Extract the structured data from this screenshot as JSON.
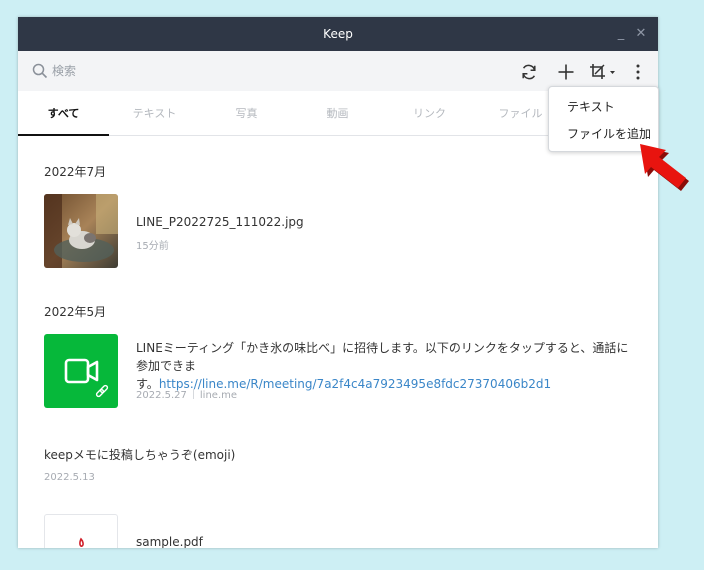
{
  "window": {
    "title": "Keep",
    "minimize_symbol": "_",
    "close_symbol": "✕"
  },
  "toolbar": {
    "search_placeholder": "検索",
    "icons": [
      "search-icon",
      "refresh-icon",
      "plus-icon",
      "crop-icon",
      "more-icon"
    ]
  },
  "tabs": [
    {
      "label": "すべて",
      "active": true
    },
    {
      "label": "テキスト",
      "active": false
    },
    {
      "label": "写真",
      "active": false
    },
    {
      "label": "動画",
      "active": false
    },
    {
      "label": "リンク",
      "active": false
    },
    {
      "label": "ファイル",
      "active": false
    }
  ],
  "sections": [
    {
      "title": "2022年7月",
      "items": [
        {
          "title": "LINE_P2022725_111022.jpg",
          "sub": "15分前"
        }
      ]
    },
    {
      "title": "2022年5月",
      "items": [
        {
          "desc_line1": "LINEミーティング「かき氷の味比べ」に招待します。以下のリンクをタップすると、通話に参加できま",
          "desc_line2_prefix": "す。",
          "link": "https://line.me/R/meeting/7a2f4c4a7923495e8fdc27370406b2d1",
          "date": "2022.5.27",
          "source": "line.me"
        }
      ]
    }
  ],
  "memo": {
    "text": "keepメモに投稿しちゃうぞ(emoji)",
    "date": "2022.5.13"
  },
  "file": {
    "name": "sample.pdf"
  },
  "popup_menu": {
    "items": [
      "テキスト",
      "ファイルを追加"
    ]
  },
  "colors": {
    "titlebar": "#2f3746",
    "meeting_green": "#06b83a",
    "link": "#3a86c8",
    "arrow": "#e8140f"
  }
}
